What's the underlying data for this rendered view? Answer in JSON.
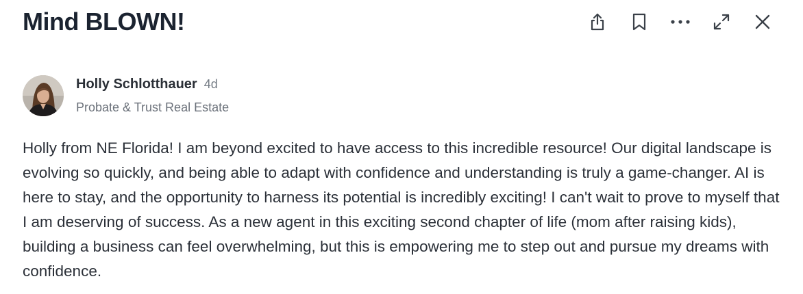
{
  "post": {
    "title": "Mind BLOWN!",
    "author": {
      "name": "Holly Schlotthauer",
      "age": "4d",
      "subtitle": "Probate & Trust Real Estate"
    },
    "body": "Holly from NE Florida! I am beyond excited to have access to this incredible resource! Our digital landscape is evolving so quickly, and being able to adapt with confidence and understanding is truly a game-changer. AI is here to stay, and the opportunity to harness its potential is incredibly exciting! I can't wait to prove to myself that I am deserving of success. As a new agent in this exciting second chapter of life (mom after raising kids), building a business can feel overwhelming, but this is empowering me to step out and pursue my dreams with confidence."
  },
  "toolbar": {
    "icons": [
      "share-icon",
      "bookmark-icon",
      "more-icon",
      "expand-icon",
      "close-icon"
    ]
  },
  "colors": {
    "title": "#1b2330",
    "text": "#2b3038",
    "muted": "#6b717a",
    "icon": "#3a4048"
  }
}
